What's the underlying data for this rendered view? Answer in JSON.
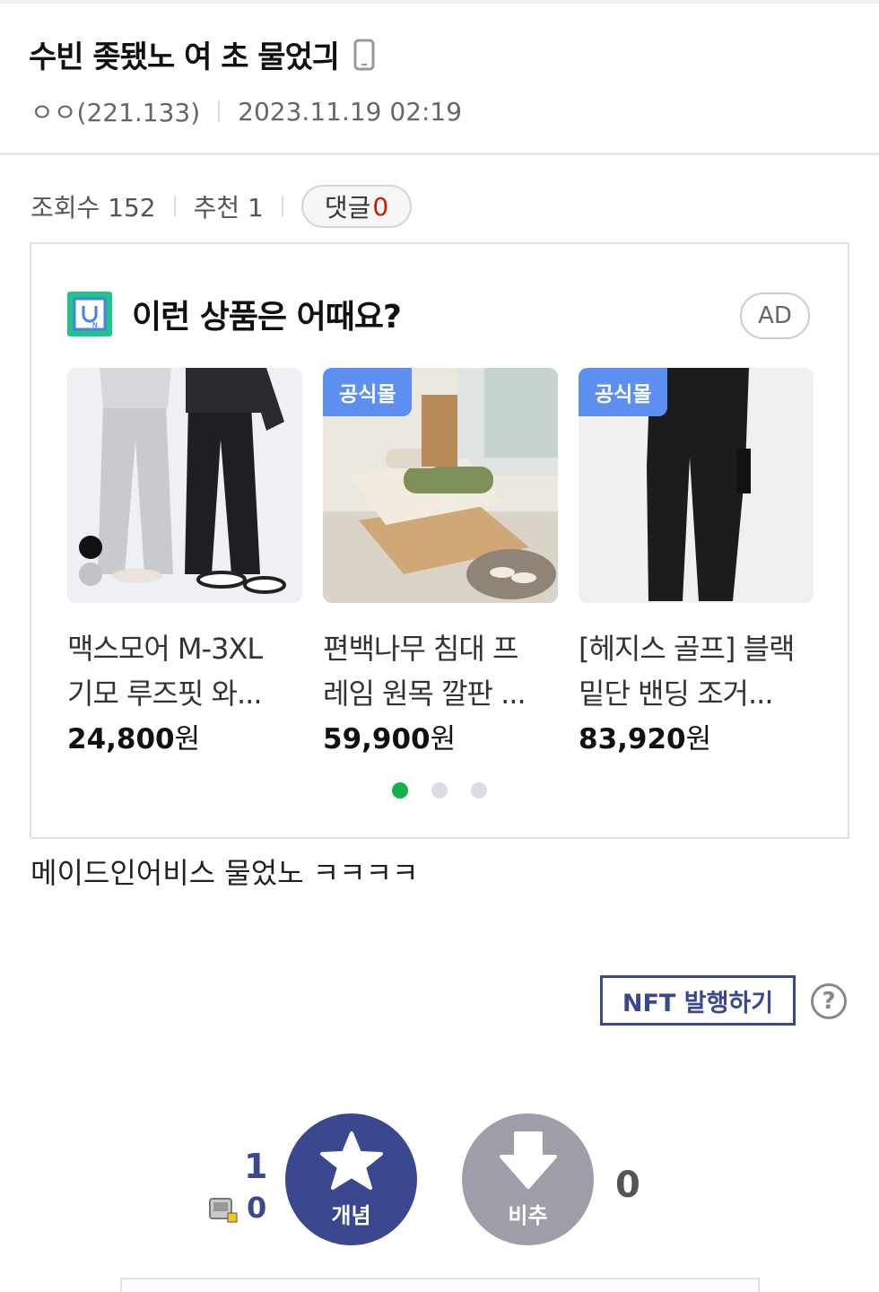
{
  "post": {
    "title": "수빈 좆됐노 여 초 물었긔",
    "author": "ㅇㅇ(221.133)",
    "datetime": "2023.11.19 02:19",
    "device_icon": "mobile-phone-icon"
  },
  "stats": {
    "views_label": "조회수 152",
    "recommend_label": "추천 1",
    "comment_label": "댓글",
    "comment_count": "0"
  },
  "ad": {
    "title": "이런 상품은 어때요?",
    "badge": "AD",
    "logo_icon": "shopping-logo-icon",
    "products": [
      {
        "official": "",
        "name_line1": "맥스모어 M-3XL",
        "name_line2": "기모 루즈핏 와...",
        "price": "24,800",
        "currency": "원"
      },
      {
        "official": "공식몰",
        "name_line1": "편백나무 침대 프",
        "name_line2": "레임 원목 깔판 ...",
        "price": "59,900",
        "currency": "원"
      },
      {
        "official": "공식몰",
        "name_line1": "[헤지스 골프] 블랙",
        "name_line2": "밑단 밴딩 조거...",
        "price": "83,920",
        "currency": "원"
      }
    ],
    "pagination": {
      "pages": 3,
      "active": 1
    }
  },
  "content": {
    "body": "메이드인어비스 물었노 ㅋㅋㅋㅋ"
  },
  "actions": {
    "nft_label": "NFT 발행하기",
    "help_label": "?"
  },
  "votes": {
    "up_count": "1",
    "fixed_count": "0",
    "up_label": "개념",
    "down_label": "비추",
    "down_count": "0"
  },
  "colors": {
    "brand": "#3b4890",
    "downvote": "#9d9ea7",
    "comment_count": "#d31900",
    "official_badge": "#5c8ff0",
    "active_dot": "#15b04b"
  }
}
